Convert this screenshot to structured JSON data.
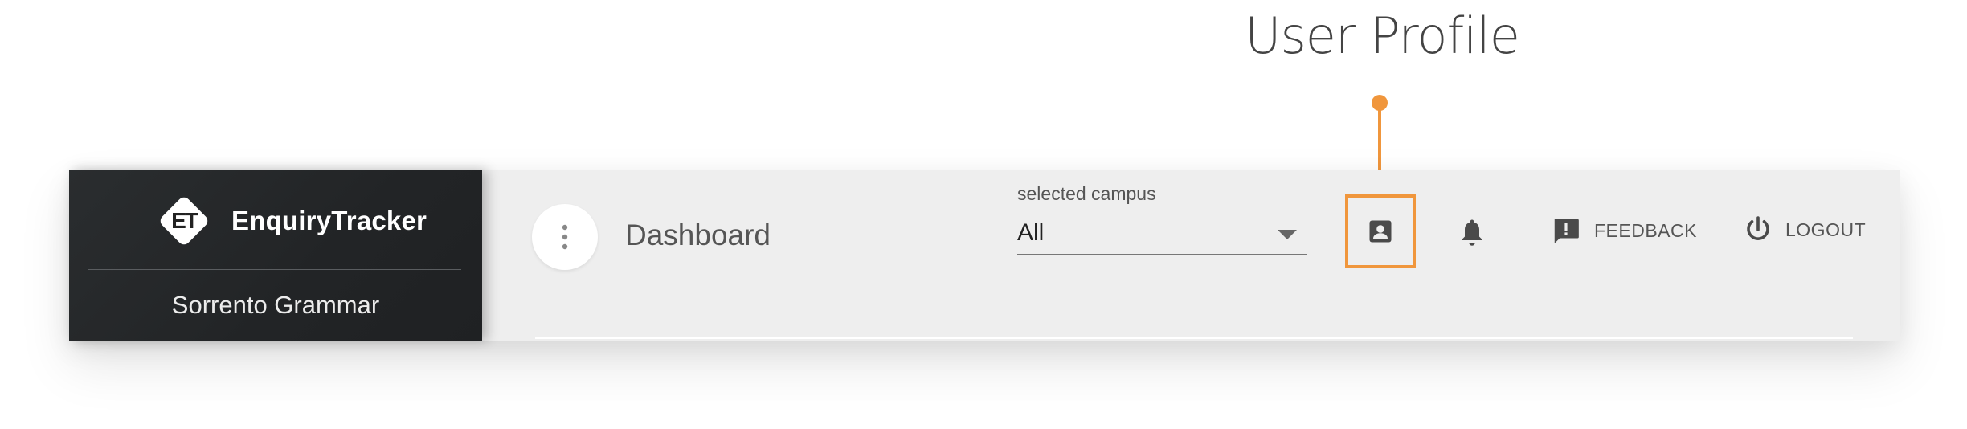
{
  "callout": {
    "title": "User Profile",
    "accent": "#f0963c"
  },
  "sidebar": {
    "logo_mark": "ET",
    "logo_text": "EnquiryTracker",
    "school_name": "Sorrento Grammar"
  },
  "header": {
    "page_title": "Dashboard",
    "campus": {
      "label": "selected campus",
      "selected": "All"
    },
    "feedback_label": "FEEDBACK",
    "logout_label": "LOGOUT"
  },
  "icons": [
    "more-vert-icon",
    "account-box-icon",
    "bell-icon",
    "feedback-icon",
    "power-icon",
    "dropdown-arrow-icon"
  ]
}
